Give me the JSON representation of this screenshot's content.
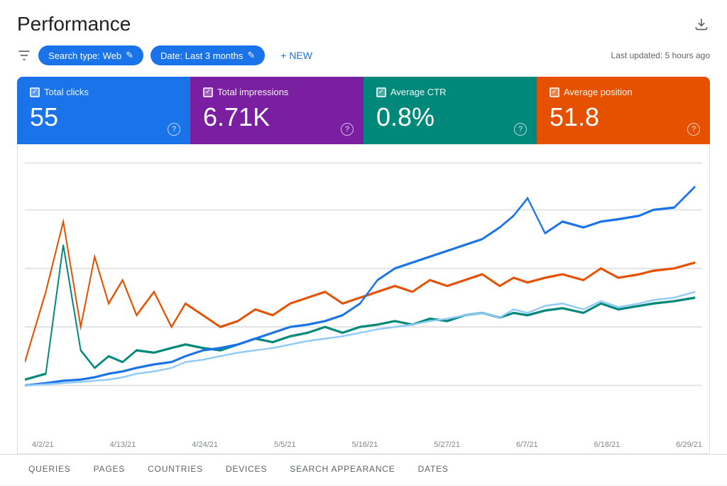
{
  "header": {
    "title": "Performance",
    "last_updated": "Last updated: 5 hours ago"
  },
  "toolbar": {
    "filter_icon_label": "filter",
    "search_type_chip": "Search type: Web",
    "date_chip": "Date: Last 3 months",
    "new_button": "+ NEW"
  },
  "metrics": [
    {
      "id": "clicks",
      "label": "Total clicks",
      "value": "55",
      "checked": true,
      "color": "#1a73e8"
    },
    {
      "id": "impressions",
      "label": "Total impressions",
      "value": "6.71K",
      "checked": true,
      "color": "#7b1fa2"
    },
    {
      "id": "ctr",
      "label": "Average CTR",
      "value": "0.8%",
      "checked": true,
      "color": "#00897b"
    },
    {
      "id": "position",
      "label": "Average position",
      "value": "51.8",
      "checked": true,
      "color": "#e65100"
    }
  ],
  "chart": {
    "x_labels": [
      "4/2/21",
      "4/13/21",
      "4/24/21",
      "5/5/21",
      "5/16/21",
      "5/27/21",
      "6/7/21",
      "6/18/21",
      "6/29/21"
    ]
  },
  "bottom_tabs": [
    {
      "label": "QUERIES",
      "active": false
    },
    {
      "label": "PAGES",
      "active": false
    },
    {
      "label": "COUNTRIES",
      "active": false
    },
    {
      "label": "DEVICES",
      "active": false
    },
    {
      "label": "SEARCH APPEARANCE",
      "active": false
    },
    {
      "label": "DATES",
      "active": false
    }
  ]
}
